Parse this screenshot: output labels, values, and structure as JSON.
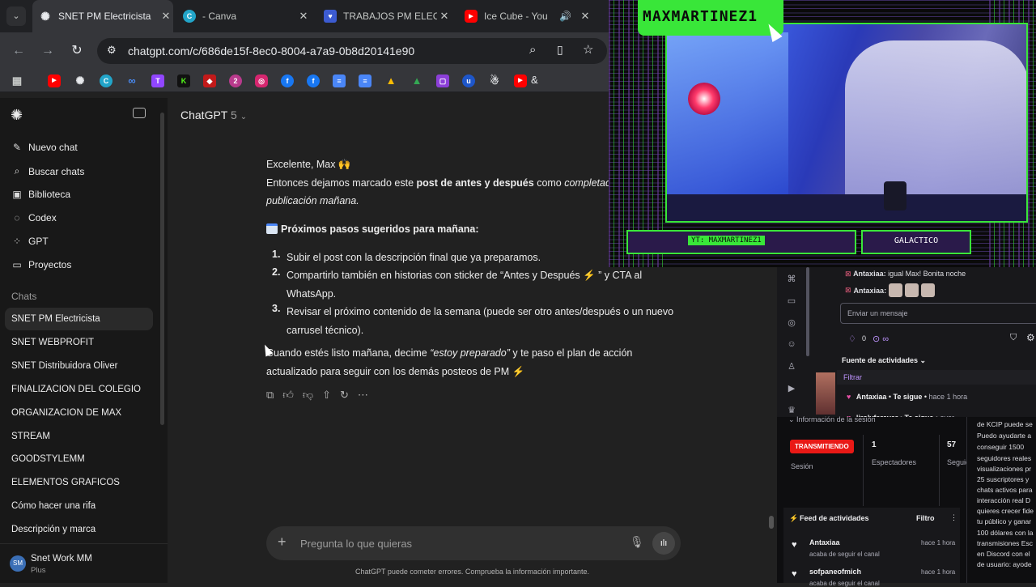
{
  "browser": {
    "tabs": [
      {
        "title": "SNET PM Electricista",
        "icon": "chatgpt",
        "active": true
      },
      {
        "title": "- Canva",
        "icon": "canva",
        "active": false
      },
      {
        "title": "TRABAJOS PM ELEC",
        "icon": "heart",
        "active": false
      },
      {
        "title": "Ice Cube - You",
        "icon": "youtube",
        "active": false
      }
    ],
    "url": "chatgpt.com/c/686de15f-8ec0-8004-a7a9-0b8d20141e90",
    "bookmark_extra": "&"
  },
  "sidebar": {
    "top_items": [
      "Nuevo chat",
      "Buscar chats",
      "Biblioteca",
      "Codex",
      "GPT",
      "Proyectos"
    ],
    "section_label": "Chats",
    "chats": [
      "SNET PM Electricista",
      "SNET WEBPROFIT",
      "SNET Distribuidora Oliver",
      "FINALIZACION DEL COLEGIO",
      "ORGANIZACION DE MAX",
      "STREAM",
      "GOODSTYLEMM",
      "ELEMENTOS GRAFICOS",
      "Cómo hacer una rifa",
      "Descripción y marca"
    ],
    "user": {
      "initials": "SM",
      "name": "Snet Work MM",
      "plan": "Plus"
    }
  },
  "header": {
    "model": "ChatGPT",
    "version": "5"
  },
  "message": {
    "greeting": "Excelente, Max 🙌",
    "line1_pre": "Entonces dejamos marcado este ",
    "line1_bold": "post de antes y después",
    "line1_mid": " como ",
    "line1_ital": "completad",
    "line2": "publicación mañana.",
    "steps_title": "Próximos pasos sugeridos para mañana:",
    "steps": [
      {
        "n": "1.",
        "text": "Subir el post con la descripción final que ya preparamos."
      },
      {
        "n": "2.",
        "text": "Compartirlo también en historias con sticker de “Antes y Después ⚡ ” y CTA al",
        "text2": "WhatsApp."
      },
      {
        "n": "3.",
        "text": "Revisar el próximo contenido de la semana (puede ser otro antes/después o un nuevo",
        "text2": "carrusel técnico)."
      }
    ],
    "closing_pre": "Cuando estés listo mañana, decime ",
    "closing_ital": "“estoy preparado”",
    "closing_post": " y te paso el plan de acción",
    "closing_line2": "actualizado para seguir con los demás posteos de PM ⚡"
  },
  "composer": {
    "placeholder": "Pregunta lo que quieras",
    "disclaimer": "ChatGPT puede cometer errores. Comprueba la información importante."
  },
  "stream": {
    "name": "MAXMARTINEZ1",
    "handle": "YT: MAXMARTINEZ1",
    "tag": "GALACTICO"
  },
  "twitch": {
    "chat": [
      {
        "user": "Antaxiaa:",
        "text": "igual Max! Bonita noche"
      },
      {
        "user": "Antaxiaa:",
        "text": ""
      }
    ],
    "input_placeholder": "Enviar un mensaje",
    "points": "0",
    "feed_title": "Fuente de actividades",
    "filter": "Filtrar",
    "events": [
      {
        "user": "Antaxiaa",
        "action": "Te sigue",
        "time": "hace 1 hora"
      },
      {
        "user": "lirolyferever",
        "action": "Te sigue",
        "time": "ayer"
      }
    ]
  },
  "dashboard": {
    "session_header": "Información de la sesión",
    "live_badge": "TRANSMITIENDO",
    "session_label": "Sesión",
    "viewers": "1",
    "viewers_label": "Espectadores",
    "followers": "57",
    "followers_label": "Seguid",
    "feed_title": "Feed de actividades",
    "feed_filter": "Filtro",
    "feed": [
      {
        "user": "Antaxiaa",
        "action": "acaba de seguir el canal",
        "time": "hace 1 hora"
      },
      {
        "user": "sofpaneofmich",
        "action": "acaba de seguir el canal",
        "time": "hace 1 hora"
      }
    ],
    "ad_text": [
      "de KCIP puede se",
      "Puedo ayudarte a",
      "conseguir 1500",
      "seguidores reales",
      "visualizaciones pr",
      "25 suscriptores y",
      "chats activos para",
      "interacción real D",
      "quieres crecer fide",
      "tu público y ganar",
      "100 dólares con la",
      "transmisiones Esc",
      "en Discord con el",
      "de usuario: ayode"
    ]
  }
}
